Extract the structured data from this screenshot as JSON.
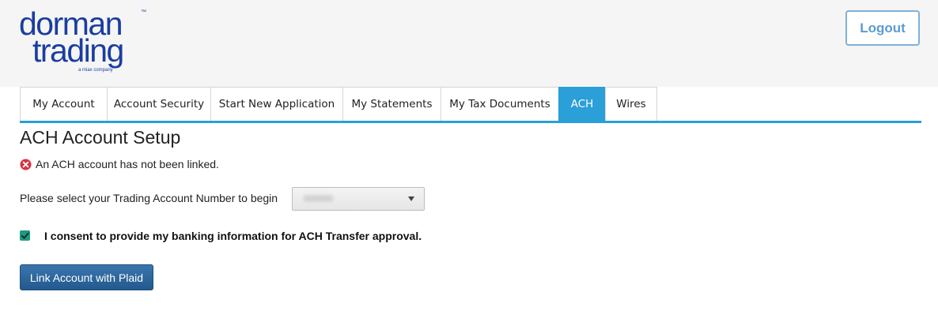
{
  "brand": {
    "line1": "dorman",
    "line2": "trading",
    "tagline": "a miax company",
    "trademark": "™",
    "color": "#1a3da0"
  },
  "header": {
    "logout_label": "Logout"
  },
  "tabs": [
    {
      "label": "My Account",
      "active": false
    },
    {
      "label": "Account Security",
      "active": false
    },
    {
      "label": "Start New Application",
      "active": false
    },
    {
      "label": "My Statements",
      "active": false
    },
    {
      "label": "My Tax Documents",
      "active": false
    },
    {
      "label": "ACH",
      "active": true
    },
    {
      "label": "Wires",
      "active": false
    }
  ],
  "main": {
    "title": "ACH Account Setup",
    "status_message": "An ACH account has not been linked.",
    "status_icon": "error-circle-icon",
    "select_label": "Please select your Trading Account Number to begin",
    "selected_account": "000000",
    "consent_text": "I consent to provide my banking information for ACH Transfer approval.",
    "consent_checked": true,
    "link_button_label": "Link Account with Plaid"
  },
  "colors": {
    "accent": "#2a9fd8",
    "button": "#2a6299",
    "error": "#d9333f",
    "checkbox": "#1f9a82"
  }
}
